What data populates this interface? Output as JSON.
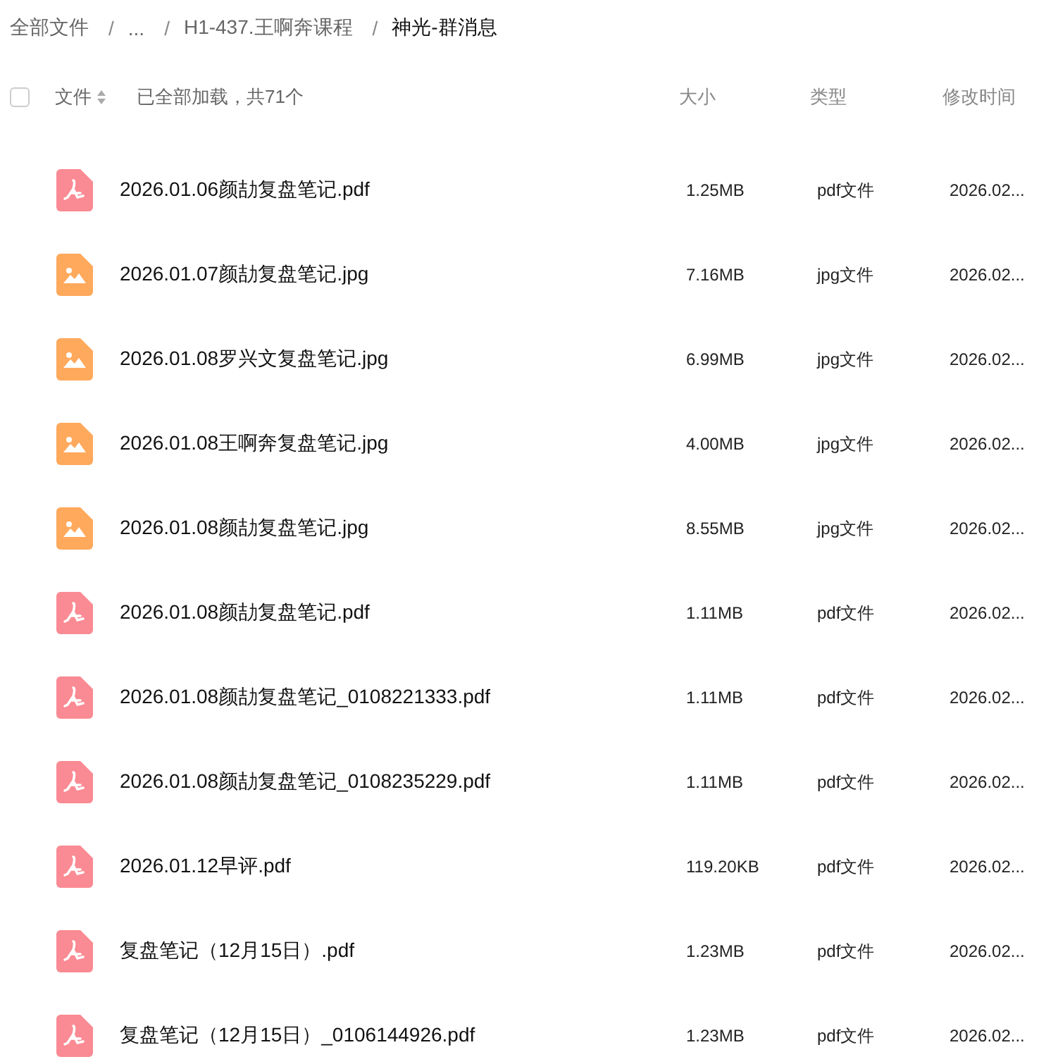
{
  "breadcrumb": [
    {
      "label": "全部文件",
      "current": false
    },
    {
      "separator": "/",
      "label": "...",
      "current": false
    },
    {
      "separator": "/",
      "label": "H1-437.王啊奔课程",
      "current": false
    },
    {
      "separator": "/",
      "label": "神光-群消息",
      "current": true
    }
  ],
  "header": {
    "select_all": {
      "checked": false
    },
    "name_column": "文件",
    "status": "已全部加载，共71个",
    "size_column": "大小",
    "type_column": "类型",
    "modified_column": "修改时间"
  },
  "files": [
    {
      "kind": "pdf",
      "name": "2026.01.06颜劼复盘笔记.pdf",
      "size": "1.25MB",
      "type": "pdf文件",
      "modified": "2026.02..."
    },
    {
      "kind": "image",
      "name": "2026.01.07颜劼复盘笔记.jpg",
      "size": "7.16MB",
      "type": "jpg文件",
      "modified": "2026.02..."
    },
    {
      "kind": "image",
      "name": "2026.01.08罗兴文复盘笔记.jpg",
      "size": "6.99MB",
      "type": "jpg文件",
      "modified": "2026.02..."
    },
    {
      "kind": "image",
      "name": "2026.01.08王啊奔复盘笔记.jpg",
      "size": "4.00MB",
      "type": "jpg文件",
      "modified": "2026.02..."
    },
    {
      "kind": "image",
      "name": "2026.01.08颜劼复盘笔记.jpg",
      "size": "8.55MB",
      "type": "jpg文件",
      "modified": "2026.02..."
    },
    {
      "kind": "pdf",
      "name": "2026.01.08颜劼复盘笔记.pdf",
      "size": "1.11MB",
      "type": "pdf文件",
      "modified": "2026.02..."
    },
    {
      "kind": "pdf",
      "name": "2026.01.08颜劼复盘笔记_0108221333.pdf",
      "size": "1.11MB",
      "type": "pdf文件",
      "modified": "2026.02..."
    },
    {
      "kind": "pdf",
      "name": "2026.01.08颜劼复盘笔记_0108235229.pdf",
      "size": "1.11MB",
      "type": "pdf文件",
      "modified": "2026.02..."
    },
    {
      "kind": "pdf",
      "name": "2026.01.12早评.pdf",
      "size": "119.20KB",
      "type": "pdf文件",
      "modified": "2026.02..."
    },
    {
      "kind": "pdf",
      "name": "复盘笔记（12月15日）.pdf",
      "size": "1.23MB",
      "type": "pdf文件",
      "modified": "2026.02..."
    },
    {
      "kind": "pdf",
      "name": "复盘笔记（12月15日）_0106144926.pdf",
      "size": "1.23MB",
      "type": "pdf文件",
      "modified": "2026.02..."
    }
  ]
}
